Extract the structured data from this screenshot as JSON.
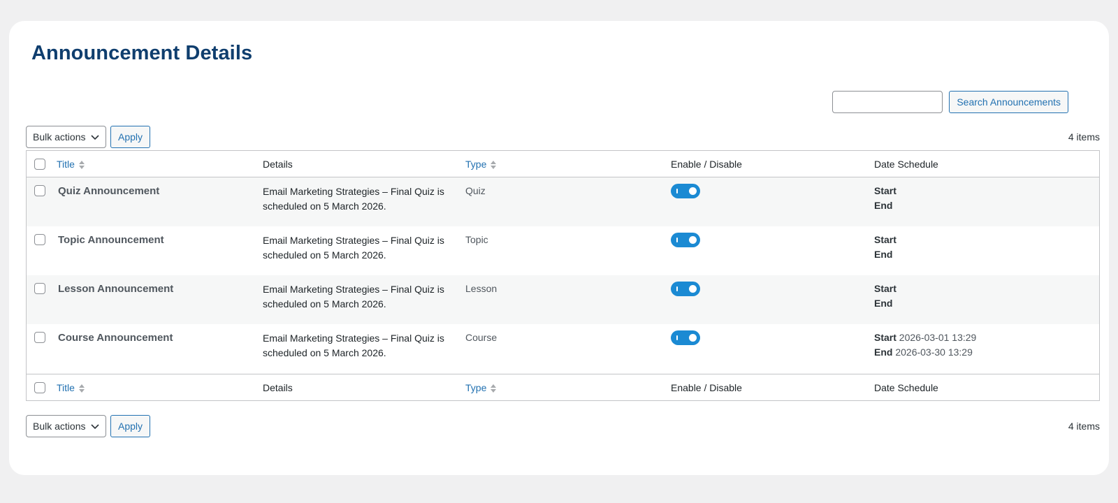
{
  "page": {
    "title": "Announcement Details"
  },
  "search": {
    "placeholder": "",
    "value": "",
    "button_label": "Search Announcements"
  },
  "tablenav": {
    "bulk_label": "Bulk actions",
    "apply_label": "Apply",
    "items_count": "4 items"
  },
  "columns": {
    "title": "Title",
    "details": "Details",
    "type": "Type",
    "enable": "Enable / Disable",
    "date": "Date Schedule"
  },
  "rows": [
    {
      "title": "Quiz Announcement",
      "details": "Email Marketing Strategies – Final Quiz is scheduled on 5 March 2026.",
      "type": "Quiz",
      "enabled": true,
      "start_label": "Start",
      "start_value": "",
      "end_label": "End",
      "end_value": ""
    },
    {
      "title": "Topic Announcement",
      "details": "Email Marketing Strategies – Final Quiz is scheduled on 5 March 2026.",
      "type": "Topic",
      "enabled": true,
      "start_label": "Start",
      "start_value": "",
      "end_label": "End",
      "end_value": ""
    },
    {
      "title": "Lesson Announcement",
      "details": "Email Marketing Strategies – Final Quiz is scheduled on 5 March 2026.",
      "type": "Lesson",
      "enabled": true,
      "start_label": "Start",
      "start_value": "",
      "end_label": "End",
      "end_value": ""
    },
    {
      "title": "Course Announcement",
      "details": "Email Marketing Strategies – Final Quiz is scheduled on 5 March 2026.",
      "type": "Course",
      "enabled": true,
      "start_label": "Start",
      "start_value": "2026-03-01 13:29",
      "end_label": "End",
      "end_value": "2026-03-30 13:29"
    }
  ],
  "colors": {
    "accent": "#2271b1",
    "toggle_on": "#1b8ad3",
    "title": "#0f3e6e"
  },
  "icons": {
    "sort": "sort-arrows-icon",
    "dropdown": "chevron-down-icon",
    "toggle": "toggle-switch-icon"
  }
}
